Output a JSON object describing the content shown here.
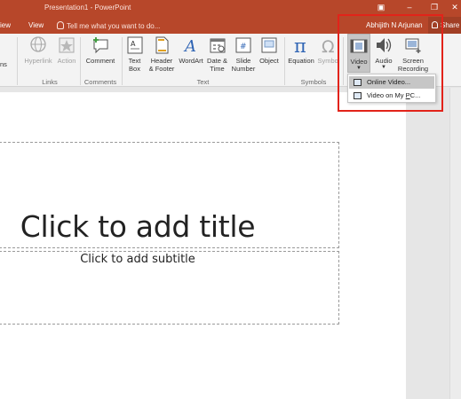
{
  "window": {
    "title": "Presentation1 - PowerPoint",
    "restore_glyph": "❐",
    "minimize_glyph": "▣",
    "close_glyph": "✕"
  },
  "tabs": {
    "view_partial": "iew",
    "view": "View",
    "tell_me": "Tell me what you want to do..."
  },
  "account": {
    "user_name": "Abhijith N Arjunan",
    "share_label": "Share"
  },
  "ribbon": {
    "partial_left_label": "ns",
    "groups": {
      "links": "Links",
      "comments": "Comments",
      "text": "Text",
      "symbols": "Symbols"
    },
    "buttons": {
      "hyperlink": "Hyperlink",
      "action": "Action",
      "comment": "Comment",
      "text_box_1": "Text",
      "text_box_2": "Box",
      "header_footer_1": "Header",
      "header_footer_2": "& Footer",
      "wordart": "WordArt",
      "date_time_1": "Date &",
      "date_time_2": "Time",
      "slide_number_1": "Slide",
      "slide_number_2": "Number",
      "object": "Object",
      "equation": "Equation",
      "symbol": "Symbol",
      "video": "Video",
      "audio": "Audio",
      "screen_recording_1": "Screen",
      "screen_recording_2": "Recording"
    }
  },
  "video_menu": {
    "online_video": "Online Video...",
    "video_on_pc_prefix": "Video on My ",
    "video_on_pc_underlined": "P",
    "video_on_pc_suffix": "C..."
  },
  "slide": {
    "title_placeholder": "Click to add title",
    "subtitle_placeholder": "Click to add subtitle"
  },
  "colors": {
    "titlebar": "#b7472a",
    "highlight_box": "#e2231a",
    "ribbon_bg": "#f3f3f3"
  }
}
